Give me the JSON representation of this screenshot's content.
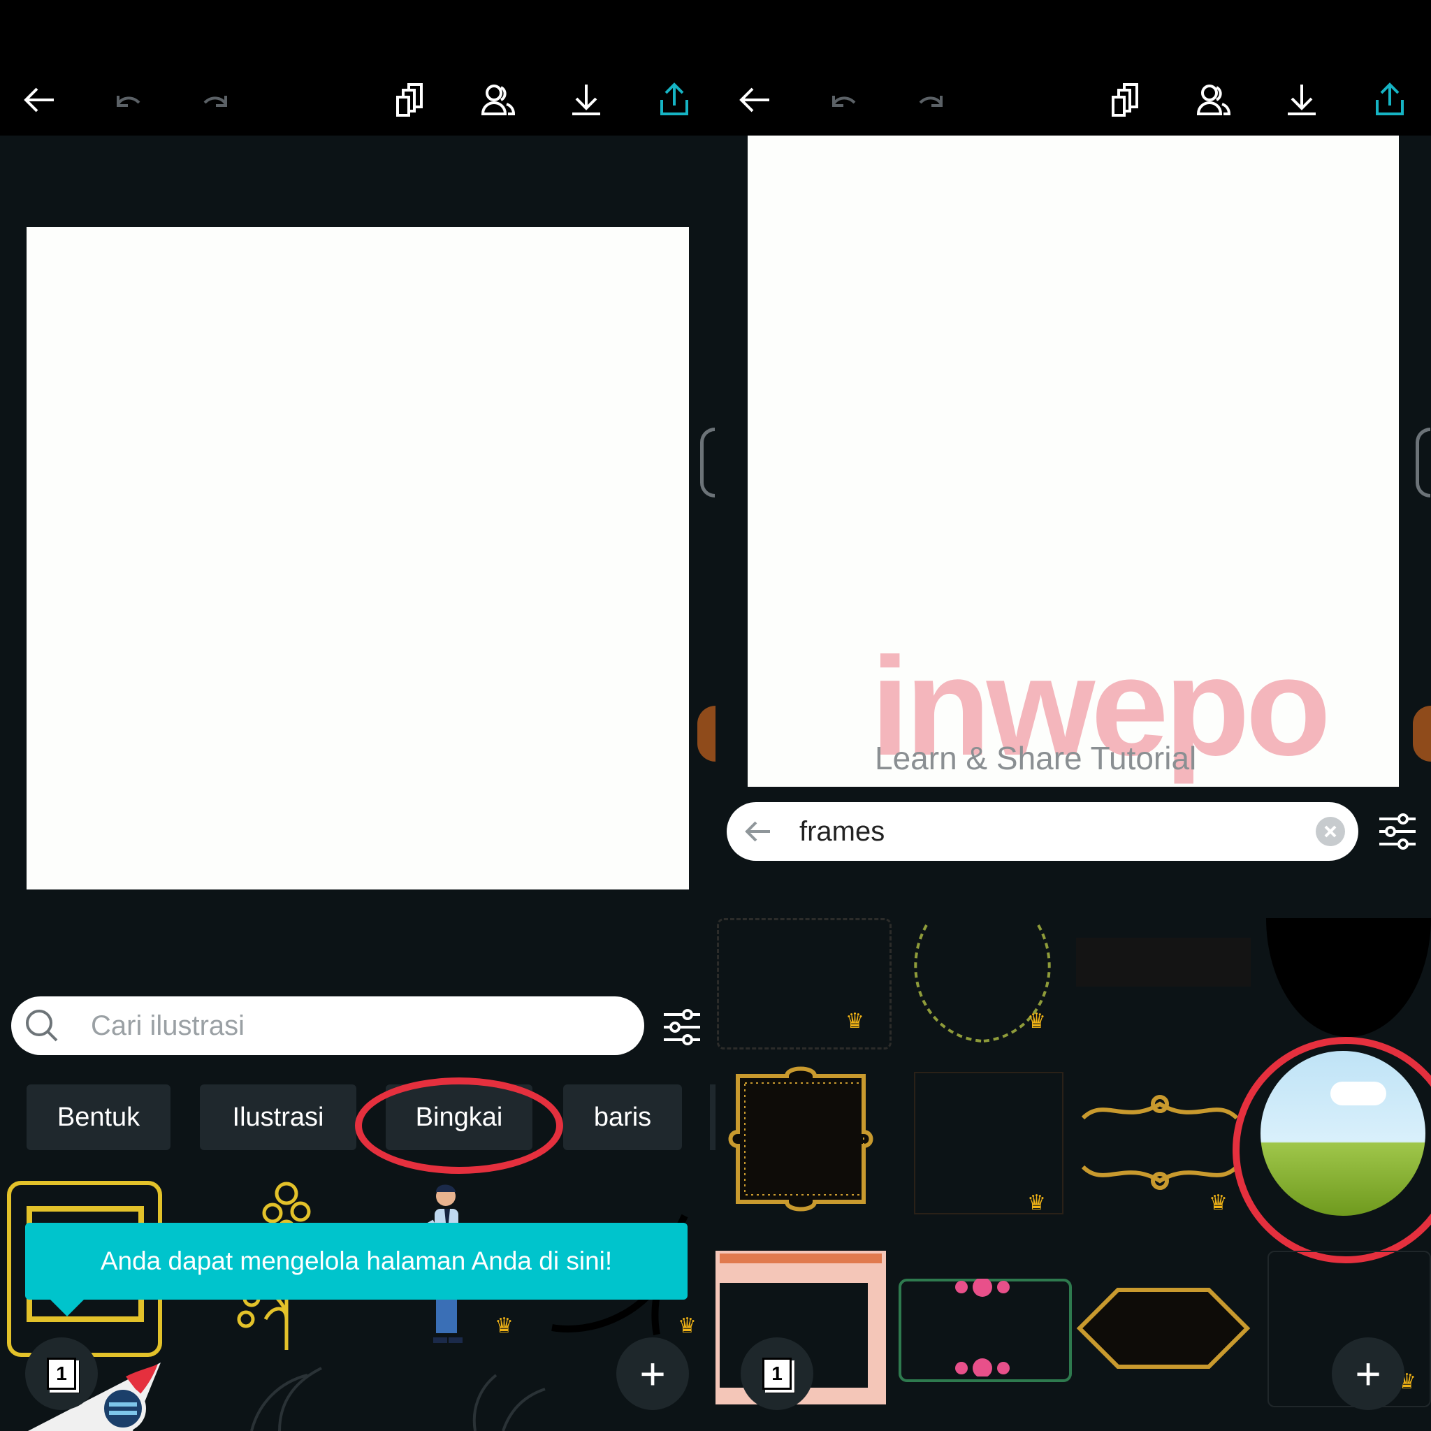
{
  "left": {
    "search": {
      "placeholder": "Cari ilustrasi"
    },
    "chips": [
      "Bentuk",
      "Ilustrasi",
      "Bingkai",
      "baris"
    ],
    "toast": "Anda dapat mengelola halaman Anda di sini!",
    "page_count": "1",
    "add_label": "+"
  },
  "right": {
    "search": {
      "value": "frames"
    },
    "page_count": "1",
    "add_label": "+"
  },
  "watermark": {
    "logo": "inwepo",
    "tagline": "Learn & Share Tutorial"
  },
  "colors": {
    "accent": "#00c4cc",
    "share_icon": "#16b4c4",
    "highlight": "#e5303e",
    "crown": "#f2b416",
    "background": "#0c1316"
  },
  "icons": [
    "back-arrow-icon",
    "undo-icon",
    "redo-icon",
    "pages-icon",
    "collaborate-icon",
    "download-icon",
    "share-icon",
    "filter-icon",
    "search-icon",
    "clear-icon",
    "crown-icon"
  ]
}
